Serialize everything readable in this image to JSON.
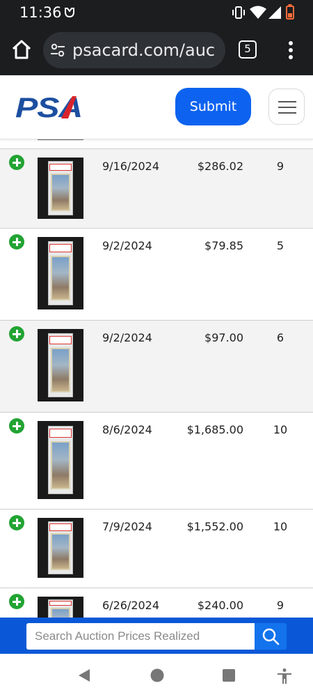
{
  "status_bar": {
    "time": "11:36",
    "icons": [
      "notification-icon",
      "vibrate-icon",
      "wifi-icon",
      "cellular-signal-icon",
      "battery-low-icon"
    ]
  },
  "browser": {
    "url": "psacard.com/auc",
    "tab_count": "5",
    "icons": [
      "home-icon",
      "site-settings-icon",
      "more-vert-icon"
    ]
  },
  "header": {
    "logo_text": "PSA",
    "submit_label": "Submit",
    "colors": {
      "brand_blue": "#1c4fa0",
      "brand_red": "#d9232a",
      "submit_blue": "#0d63ef"
    }
  },
  "results": {
    "rows": [
      {
        "date": "9/16/2024",
        "price": "$286.02",
        "grade": "9",
        "shaded": true
      },
      {
        "date": "9/2/2024",
        "price": "$79.85",
        "grade": "5",
        "shaded": false
      },
      {
        "date": "9/2/2024",
        "price": "$97.00",
        "grade": "6",
        "shaded": true
      },
      {
        "date": "8/6/2024",
        "price": "$1,685.00",
        "grade": "10",
        "shaded": false
      },
      {
        "date": "7/9/2024",
        "price": "$1,552.00",
        "grade": "10",
        "shaded": false
      },
      {
        "date": "6/26/2024",
        "price": "$240.00",
        "grade": "9",
        "shaded": false
      }
    ],
    "row_icon": "add-circle-icon",
    "row_icon_color": "#22a433"
  },
  "search": {
    "placeholder": "Search Auction Prices Realized",
    "icon": "search-icon",
    "bar_color": "#0a58d8"
  },
  "android_nav": {
    "icons": [
      "back-icon",
      "home-circle-icon",
      "recents-icon",
      "accessibility-icon"
    ]
  }
}
